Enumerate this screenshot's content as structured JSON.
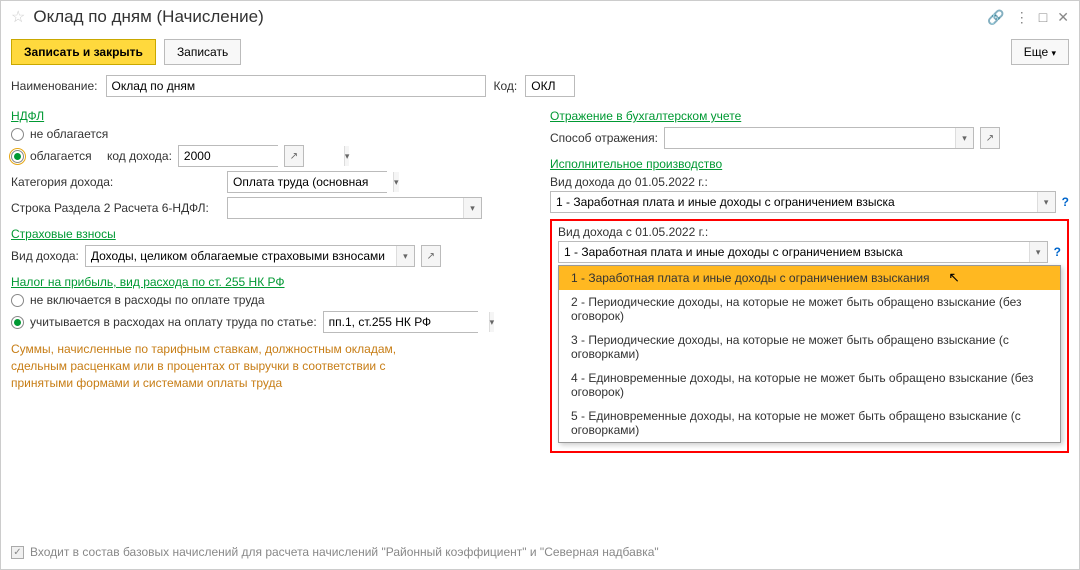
{
  "window": {
    "title": "Оклад по дням (Начисление)"
  },
  "toolbar": {
    "save_close": "Записать и закрыть",
    "save": "Записать",
    "more": "Еще"
  },
  "main": {
    "name_label": "Наименование:",
    "name_value": "Оклад по дням",
    "code_label": "Код:",
    "code_value": "ОКЛ"
  },
  "ndfl": {
    "title": "НДФЛ",
    "not_taxed": "не облагается",
    "taxed": "облагается",
    "income_code_label": "код дохода:",
    "income_code_value": "2000",
    "category_label": "Категория дохода:",
    "category_value": "Оплата труда (основная",
    "row2_label": "Строка Раздела 2 Расчета 6-НДФЛ:",
    "row2_value": ""
  },
  "insurance": {
    "title": "Страховые взносы",
    "type_label": "Вид дохода:",
    "type_value": "Доходы, целиком облагаемые страховыми взносами"
  },
  "profit_tax": {
    "title": "Налог на прибыль, вид расхода по ст. 255 НК РФ",
    "not_included": "не включается в расходы по оплате труда",
    "included": "учитывается в расходах на оплату труда по статье:",
    "article_value": "пп.1, ст.255 НК РФ",
    "note": "Суммы, начисленные по тарифным ставкам, должностным окладам, сдельным расценкам или в процентах от выручки в соответствии с принятыми формами и системами оплаты труда"
  },
  "accounting": {
    "title": "Отражение в бухгалтерском учете",
    "method_label": "Способ отражения:",
    "method_value": ""
  },
  "enforcement": {
    "title": "Исполнительное производство",
    "before_label": "Вид дохода до 01.05.2022 г.:",
    "before_value": "1 - Заработная плата и иные доходы с ограничением взыска",
    "after_label": "Вид дохода с 01.05.2022 г.:",
    "after_value": "1 - Заработная плата и иные доходы с ограничением взыска",
    "options": [
      "1 - Заработная плата и иные доходы с ограничением взыскания",
      "2 - Периодические доходы, на которые не может быть обращено взыскание (без оговорок)",
      "3 - Периодические доходы, на которые не может быть обращено взыскание (с оговорками)",
      "4 - Единовременные доходы, на которые не может быть обращено взыскание (без оговорок)",
      "5 - Единовременные доходы, на которые не может быть обращено взыскание (с оговорками)"
    ]
  },
  "footer": {
    "checkbox_label": "Входит в состав базовых начислений для расчета начислений \"Районный коэффициент\" и \"Северная надбавка\""
  }
}
